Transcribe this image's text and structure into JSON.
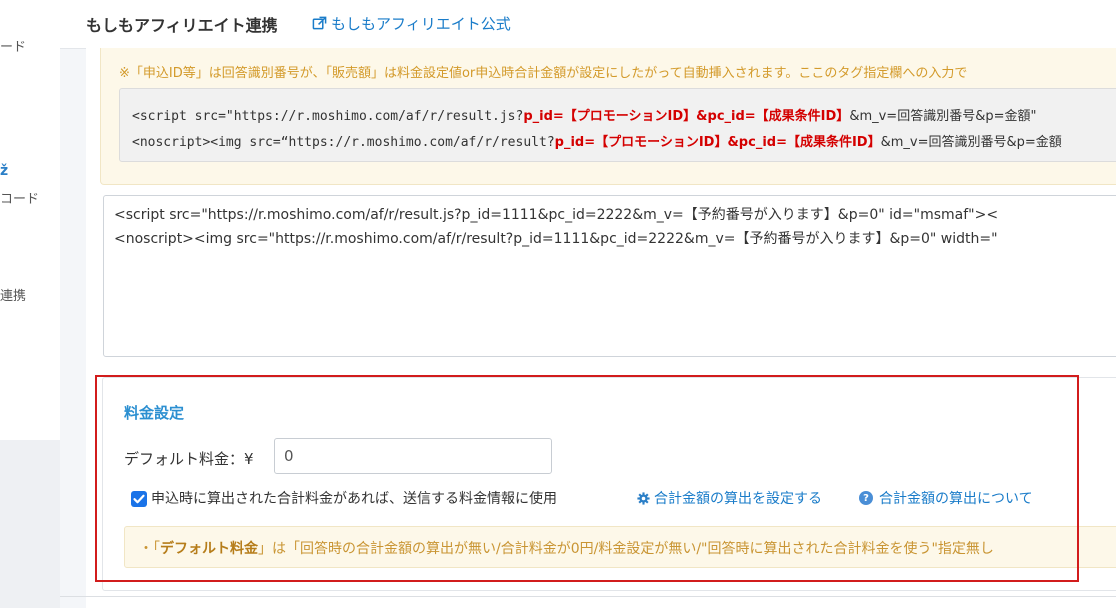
{
  "sidebar": {
    "items": [
      {
        "label": "ード"
      },
      {
        "label": "コード"
      },
      {
        "label": "連携"
      }
    ]
  },
  "header": {
    "title": "もしもアフィリエイト連携",
    "official_link": "もしもアフィリエイト公式"
  },
  "notice": {
    "text": "※「申込ID等」は回答識別番号が、「販売額」は料金設定値or申込時合計金額が設定にしたがって自動挿入されます。ここのタグ指定欄への入力で",
    "code_line1_pre": "<script src=\"https://r.moshimo.com/af/r/result.js?",
    "code_line1_red": "p_id=【プロモーションID】&pc_id=【成果条件ID】",
    "code_line1_post": "&m_v=回答識別番号&p=金額\"",
    "code_line2_pre": "<noscript><img src=“https://r.moshimo.com/af/r/result?",
    "code_line2_red": "p_id=【プロモーションID】&pc_id=【成果条件ID】",
    "code_line2_post": "&m_v=回答識別番号&p=金額"
  },
  "tag_field": {
    "line1": "<script src=\"https://r.moshimo.com/af/r/result.js?p_id=1111&pc_id=2222&m_v=【予約番号が入ります】&p=0\" id=\"msmaf\"><",
    "line2": "<noscript><img src=\"https://r.moshimo.com/af/r/result?p_id=1111&pc_id=2222&m_v=【予約番号が入ります】&p=0\" width=\""
  },
  "fee_settings": {
    "title": "料金設定",
    "default_label": "デフォルト料金：¥",
    "default_value": "0",
    "checkbox_checked": true,
    "checkbox_label": "申込時に算出された合計料金があれば、送信する料金情報に使用",
    "link_configure": "合計金額の算出を設定する",
    "link_about": "合計金額の算出について",
    "info_prefix": "・「",
    "info_bold": "デフォルト料金",
    "info_rest": "」は「回答時の合計金額の算出が無い/合計料金が0円/料金設定が無い/\"回答時に算出された合計料金を使う\"指定無し"
  },
  "colors": {
    "accent": "#1a7cc9",
    "highlight_frame": "#d21c1c",
    "notice_text": "#d39a2a"
  }
}
